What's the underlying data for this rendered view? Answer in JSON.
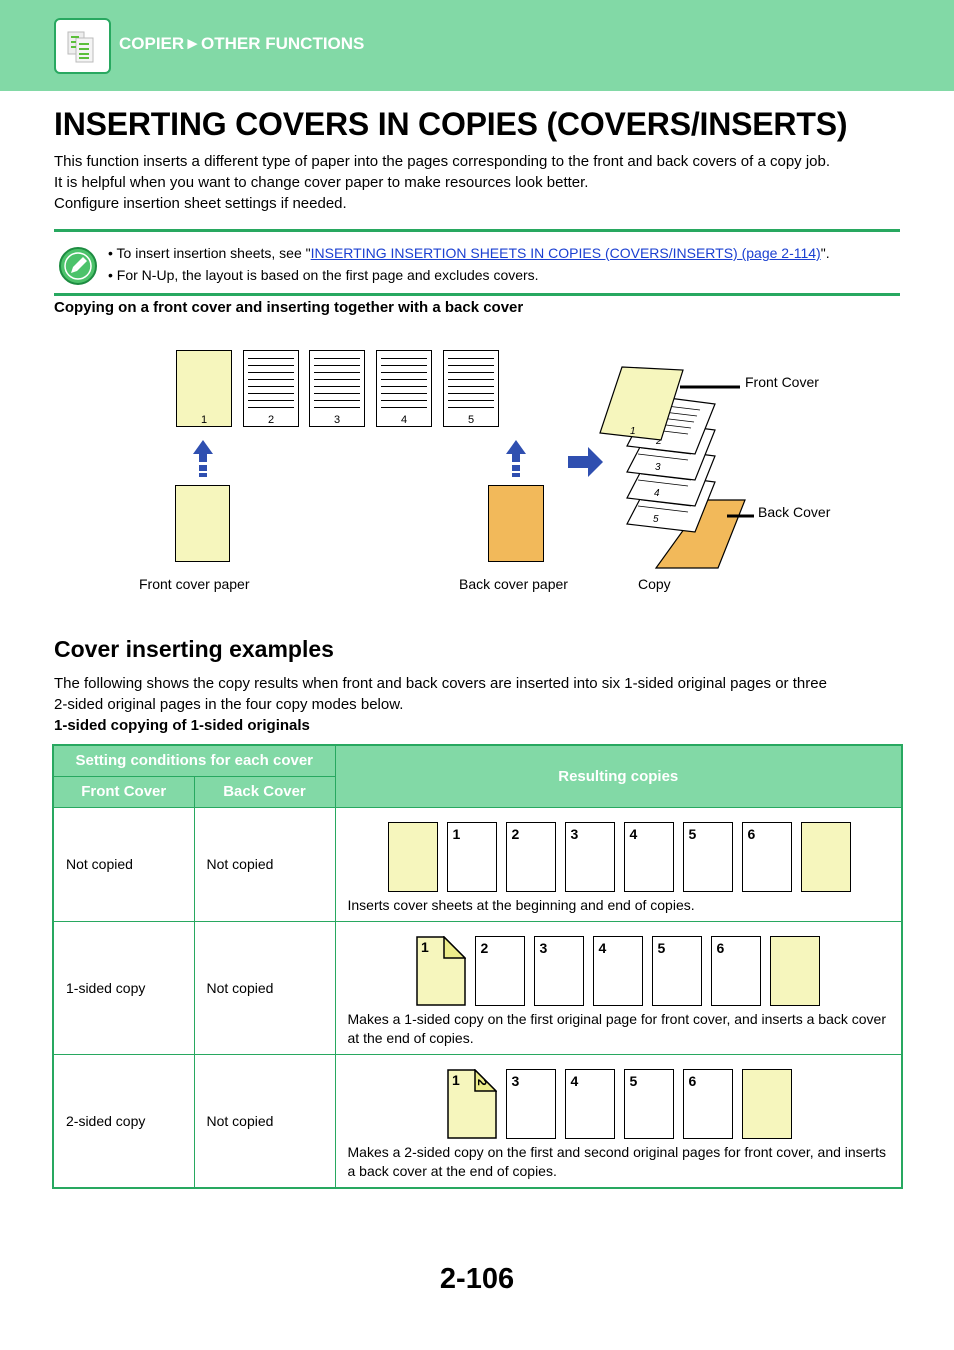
{
  "header": {
    "breadcrumb": "COPIER►OTHER FUNCTIONS",
    "icon": "copier-icon"
  },
  "title": "INSERTING COVERS IN COPIES (COVERS/INSERTS)",
  "intro": [
    "This function inserts a different type of paper into the pages corresponding to the front and back covers of a copy job.",
    "It is helpful when you want to change cover paper to make resources look better.",
    "Configure insertion sheet settings if needed."
  ],
  "note": {
    "icon": "pencil-icon",
    "item1_prefix": "To insert insertion sheets, see \"",
    "item1_link": "INSERTING INSERTION SHEETS IN COPIES (COVERS/INSERTS) (page 2-114)",
    "item1_suffix": "\".",
    "item2": "For N-Up, the layout is based on the first page and excludes covers."
  },
  "subheading": "Copying on a front cover and inserting together with a back cover",
  "diagram": {
    "pages": [
      "1",
      "2",
      "3",
      "4",
      "5"
    ],
    "front_cover_paper": "Front cover paper",
    "back_cover_paper": "Back cover paper",
    "copy": "Copy",
    "front_cover": "Front Cover",
    "back_cover": "Back Cover",
    "colors": {
      "cover": "#f6f6bd",
      "back": "#f2b95a",
      "arrow": "#2f4fb0"
    }
  },
  "examples": {
    "heading": "Cover inserting examples",
    "text": [
      "The following shows the copy results when front and back covers are inserted into six 1-sided original pages or three",
      "2-sided original pages in the four copy modes below."
    ],
    "subheading": "1-sided copying of 1-sided originals"
  },
  "table": {
    "header_group": "Setting conditions for each cover",
    "col_front": "Front Cover",
    "col_back": "Back Cover",
    "col_result": "Resulting copies",
    "rows": [
      {
        "front": "Not copied",
        "back": "Not copied",
        "pages": [
          "",
          "1",
          "2",
          "3",
          "4",
          "5",
          "6",
          ""
        ],
        "desc": "Inserts cover sheets at the beginning and end of copies."
      },
      {
        "front": "1-sided copy",
        "back": "Not copied",
        "pages": [
          "1",
          "2",
          "3",
          "4",
          "5",
          "6",
          ""
        ],
        "desc": "Makes a 1-sided copy on the first original page for front cover, and inserts a back cover at the end of copies."
      },
      {
        "front": "2-sided copy",
        "back": "Not copied",
        "pages": [
          "1|2",
          "3",
          "4",
          "5",
          "6",
          ""
        ],
        "desc": "Makes a 2-sided copy on the first and second original pages for front cover, and inserts a back cover at the end of copies."
      }
    ]
  },
  "page_number": "2-106"
}
